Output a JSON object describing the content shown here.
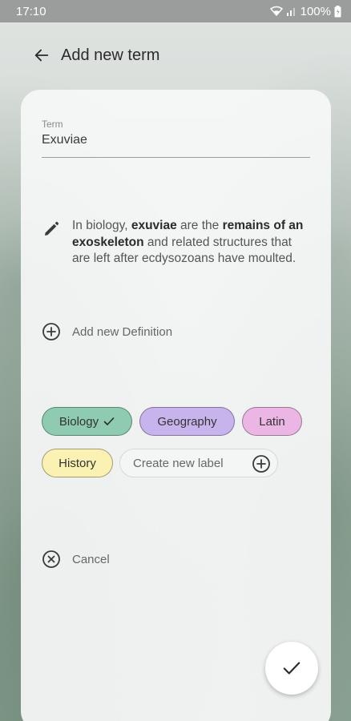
{
  "status_bar": {
    "time": "17:10",
    "battery": "100%"
  },
  "header": {
    "title": "Add new term",
    "back_icon": "arrow-left-icon"
  },
  "term": {
    "label": "Term",
    "value": "Exuviae"
  },
  "definition": {
    "icon": "pencil-icon",
    "parts": [
      {
        "text": "In biology, ",
        "bold": false
      },
      {
        "text": "exuviae",
        "bold": true
      },
      {
        "text": " are the ",
        "bold": false
      },
      {
        "text": "remains of an exoskeleton",
        "bold": true
      },
      {
        "text": " and related structures that are left after ecdysozoans have moulted.",
        "bold": false
      }
    ]
  },
  "add_definition": {
    "label": "Add new Definition",
    "icon": "plus-circle-icon"
  },
  "labels": [
    {
      "name": "Biology",
      "color": "#8ecbb0",
      "selected": true
    },
    {
      "name": "Geography",
      "color": "#c8b4ec",
      "selected": false
    },
    {
      "name": "Latin",
      "color": "#ebb6e4",
      "selected": false
    },
    {
      "name": "History",
      "color": "#faf1b2",
      "selected": false
    }
  ],
  "create_label": {
    "label": "Create new label",
    "icon": "plus-circle-icon"
  },
  "cancel": {
    "label": "Cancel",
    "icon": "close-circle-icon"
  },
  "fab": {
    "icon": "check-icon"
  }
}
